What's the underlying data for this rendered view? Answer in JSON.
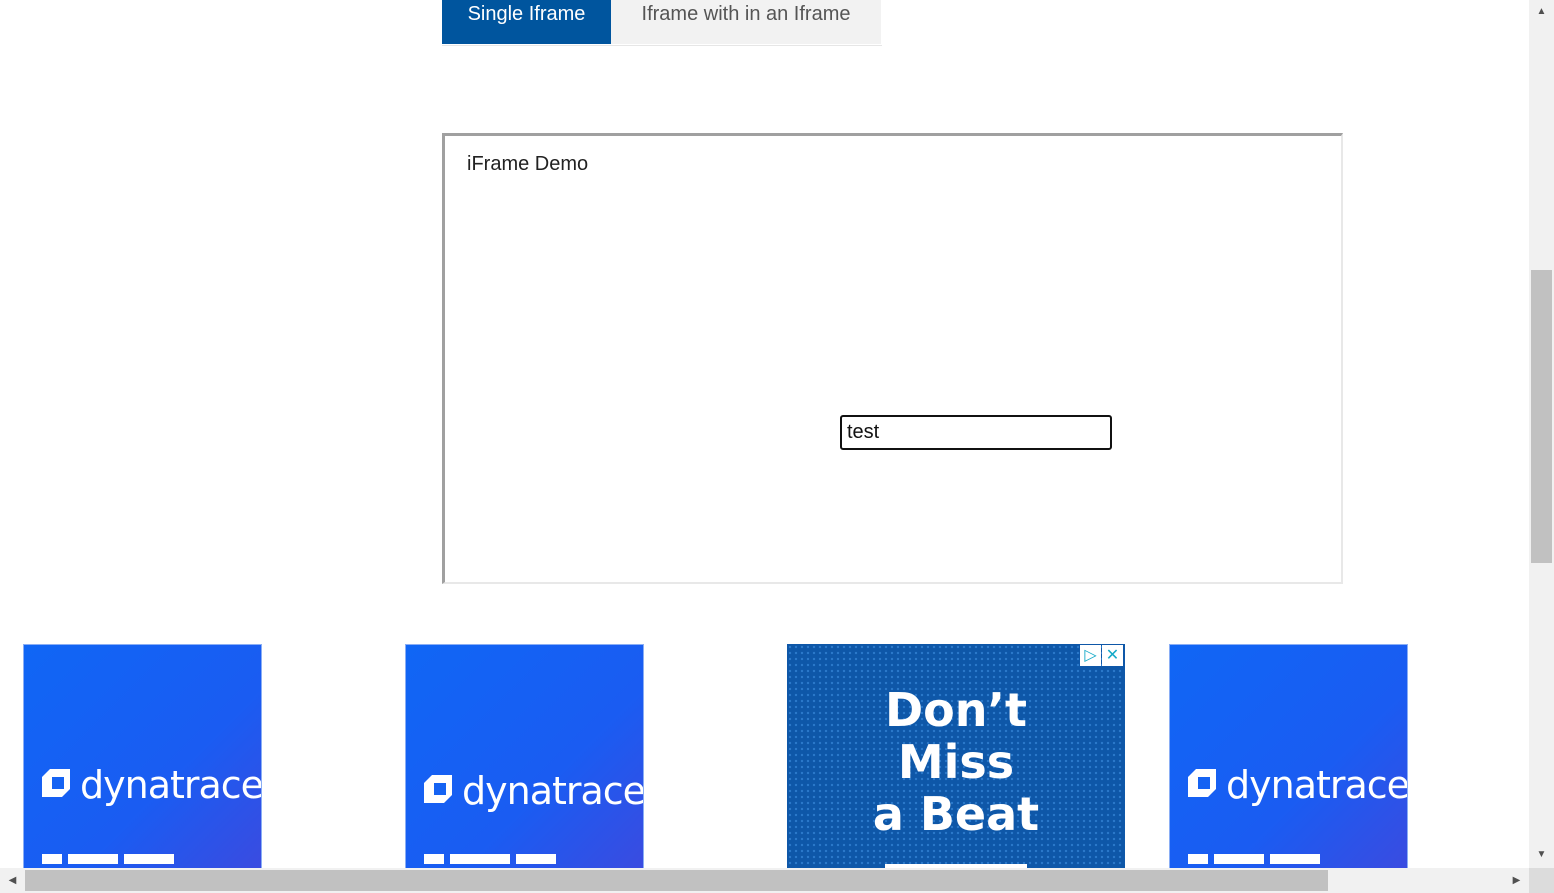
{
  "tabs": {
    "single": "Single Iframe",
    "nested": "Iframe with in an Iframe"
  },
  "iframe": {
    "title": "iFrame Demo",
    "input_value": "test"
  },
  "ads": {
    "brand": "dynatrace",
    "beat_line1": "Don’t",
    "beat_line2": "Miss",
    "beat_line3": "a Beat"
  },
  "colors": {
    "tab_active": "#00559e",
    "ad_blue": "#1066f5"
  },
  "icons": [
    "scroll-up-arrow-icon",
    "scroll-down-arrow-icon",
    "scroll-left-arrow-icon",
    "scroll-right-arrow-icon",
    "dynatrace-logo-icon",
    "adchoices-icon",
    "ad-close-icon"
  ]
}
